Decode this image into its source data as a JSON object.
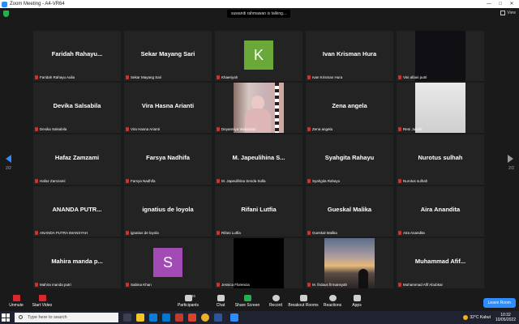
{
  "window": {
    "title": "Zoom Meeting - A4-VR64",
    "controls": [
      "—",
      "□",
      "✕"
    ]
  },
  "meeting": {
    "talking": "suwandi rahmawan is talking...",
    "view_label": "View"
  },
  "gallery": {
    "page_left": "2/2",
    "page_right": "2/2",
    "tiles": [
      {
        "big": "Faridah  Rahayu...",
        "caption": "Faridah Rahayu Aulia"
      },
      {
        "big": "Sekar Mayang Sari",
        "caption": "Sekar Mayang Sari"
      },
      {
        "big": "",
        "caption": "Khaeriyah",
        "avatar": "K",
        "avatar_color": "#6aa83a"
      },
      {
        "big": "Ivan Krisman Hura",
        "caption": "Ivan Krisman Hura"
      },
      {
        "big": "",
        "caption": "Vini afiani putri",
        "video": "dark"
      },
      {
        "big": "Devika Salsabila",
        "caption": "Devika Salsabila"
      },
      {
        "big": "Vira Hasna Arianti",
        "caption": "Vira Hasna Arianti"
      },
      {
        "big": "",
        "caption": "Deyanniya Wulandari",
        "video": "person"
      },
      {
        "big": "Zena angela",
        "caption": "Zena angela"
      },
      {
        "big": "",
        "caption": "Reni Juliarti",
        "video": "light"
      },
      {
        "big": "Hafaz Zamzami",
        "caption": "Hafaz Zamzami"
      },
      {
        "big": "Farsya Nadhifa",
        "caption": "Farsya Nadhifa"
      },
      {
        "big": "M. Japeulihina  S...",
        "caption": "M. Japeulihina Senda Solla"
      },
      {
        "big": "Syahgita Rahayu",
        "caption": "Syahgita Rahayu"
      },
      {
        "big": "Nurotus sulhah",
        "caption": "Nurotus sulhah"
      },
      {
        "big": "ANANDA  PUTR...",
        "caption": "ANANDA PUTRA IMANSYAH"
      },
      {
        "big": "ignatius de loyola",
        "caption": "ignatius de loyola"
      },
      {
        "big": "Rifani Lutfia",
        "caption": "Rifani Lutfia"
      },
      {
        "big": "Gueskal Malika",
        "caption": "Gueskal Malika"
      },
      {
        "big": "Aira Anandita",
        "caption": "Aira Anandita"
      },
      {
        "big": "Mahira manda p...",
        "caption": "Mahira manda putri"
      },
      {
        "big": "",
        "caption": "Sabina Khan",
        "avatar": "S",
        "avatar_color": "#a34bb5"
      },
      {
        "big": "",
        "caption": "Jessica Florencia",
        "video": "black"
      },
      {
        "big": "",
        "caption": "M. firdaus firmansyah",
        "video": "sunset"
      },
      {
        "big": "Muhammad  Afif...",
        "caption": "Muhammad Afif Abubkar"
      }
    ]
  },
  "toolbar": {
    "unmute": "Unmute",
    "start_video": "Start Video",
    "participants": "Participants",
    "participants_count": "35",
    "chat": "Chat",
    "share_screen": "Share Screen",
    "record": "Record",
    "breakout": "Breakout Rooms",
    "reactions": "Reactions",
    "apps": "Apps",
    "leave": "Leave Room"
  },
  "taskbar": {
    "search_placeholder": "Type here to search",
    "weather": "32°C  Kabut",
    "time": "10:32",
    "date": "10/05/2022"
  },
  "colors": {
    "accent": "#2d8cff",
    "mic_muted": "#e02828",
    "share": "#22b14c"
  }
}
